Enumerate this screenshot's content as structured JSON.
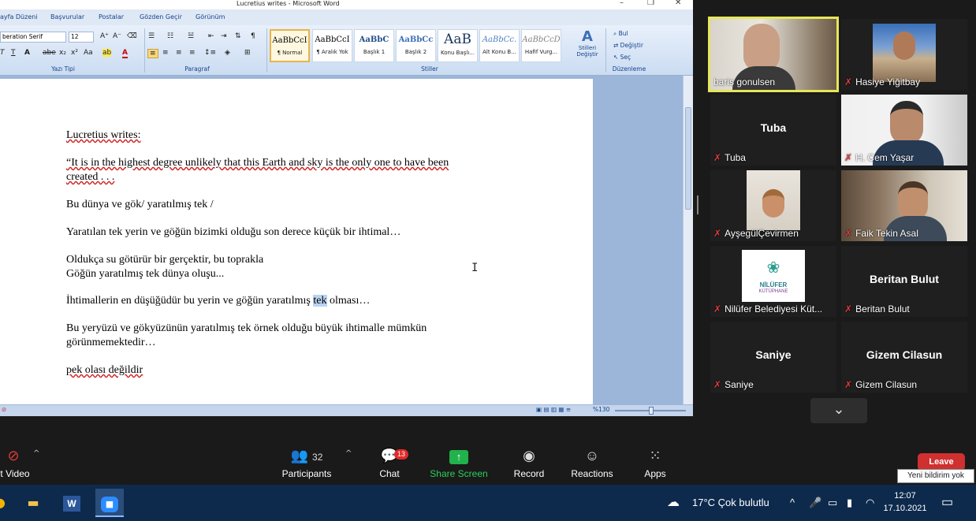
{
  "word": {
    "title": "Lucretius writes - Microsoft Word",
    "window_controls": [
      "–",
      "❐",
      "✕"
    ],
    "tabs": [
      "ayfa Düzeni",
      "Başvurular",
      "Postalar",
      "Gözden Geçir",
      "Görünüm"
    ],
    "font_name": "beration Serif",
    "font_size": "12",
    "group_labels": {
      "font": "Yazı Tipi",
      "paragraph": "Paragraf",
      "styles": "Stiller",
      "editing": "Düzenleme"
    },
    "styles": [
      {
        "sample": "AaBbCcI",
        "name": "¶ Normal"
      },
      {
        "sample": "AaBbCcI",
        "name": "¶ Aralık Yok"
      },
      {
        "sample": "AaBbC",
        "name": "Başlık 1"
      },
      {
        "sample": "AaBbCc",
        "name": "Başlık 2"
      },
      {
        "sample": "AaB",
        "name": "Konu Başlı..."
      },
      {
        "sample": "AaBbCc.",
        "name": "Alt Konu B..."
      },
      {
        "sample": "AaBbCcD",
        "name": "Hafif Vurg..."
      }
    ],
    "change_styles": "Stilleri Değiştir",
    "edit_find": "Bul",
    "edit_replace": "Değiştir",
    "edit_select": "Seç",
    "zoom": "%130",
    "document": {
      "p1": "Lucretius writes:",
      "p2a": "“It is in the highest degree unlikely that this Earth and sky is the only one to have been",
      "p2b": "created . . .",
      "p3": "Bu dünya ve gök/ yaratılmış tek /",
      "p4": "Yaratılan tek yerin ve göğün bizimki olduğu son derece küçük bir ihtimal…",
      "p5a": "Oldukça su götürür bir gerçektir, bu toprakla",
      "p5b": "Göğün yaratılmış tek dünya oluşu...",
      "p6_before": "İhtimallerin en düşüğüdür bu yerin ve göğün yaratılmış ",
      "p6_selected": "tek",
      "p6_after": " olması…",
      "p7a": "Bu yeryüzü ve gökyüzünün yaratılmış tek örnek olduğu büyük ihtimalle mümkün",
      "p7b": "görünmemektedir…",
      "p8": "pek olası değildir"
    }
  },
  "zoom": {
    "participants": [
      {
        "name": "baris gonulsen",
        "muted": false,
        "video": true,
        "active": true
      },
      {
        "name": "Hasiye Yiğitbay",
        "muted": true,
        "video": true,
        "active": false
      },
      {
        "name": "Tuba",
        "muted": true,
        "video": false,
        "active": false
      },
      {
        "name": "H. Cem Yaşar",
        "muted": true,
        "video": true,
        "active": false
      },
      {
        "name": "AyşegülÇevirmen",
        "muted": true,
        "video": true,
        "active": false
      },
      {
        "name": "Faik Tekin Asal",
        "muted": true,
        "video": true,
        "active": false
      },
      {
        "name": "Nilüfer Belediyesi Küt...",
        "muted": true,
        "video": true,
        "active": false
      },
      {
        "name": "Beritan Bulut",
        "muted": true,
        "video": false,
        "active": false
      },
      {
        "name": "Saniye",
        "muted": true,
        "video": false,
        "active": false
      },
      {
        "name": "Gizem Cilasun",
        "muted": true,
        "video": false,
        "active": false
      }
    ],
    "logo_text_1": "NİLÜFER",
    "logo_text_2": "KÜTÜPHANE",
    "toolbar": {
      "video": "rt Video",
      "participants": "Participants",
      "participants_count": "32",
      "chat": "Chat",
      "chat_badge": "13",
      "share": "Share Screen",
      "record": "Record",
      "reactions": "Reactions",
      "apps": "Apps",
      "leave": "Leave"
    },
    "tooltip": "Yeni bildirim yok"
  },
  "taskbar": {
    "weather": "17°C  Çok bulutlu",
    "time": "12:07",
    "date": "17.10.2021"
  },
  "colors": {
    "active_speaker": "#e6e65a",
    "share_green": "#2ad15a",
    "leave_red": "#d0302f",
    "mic_off_red": "#e03a3a"
  }
}
